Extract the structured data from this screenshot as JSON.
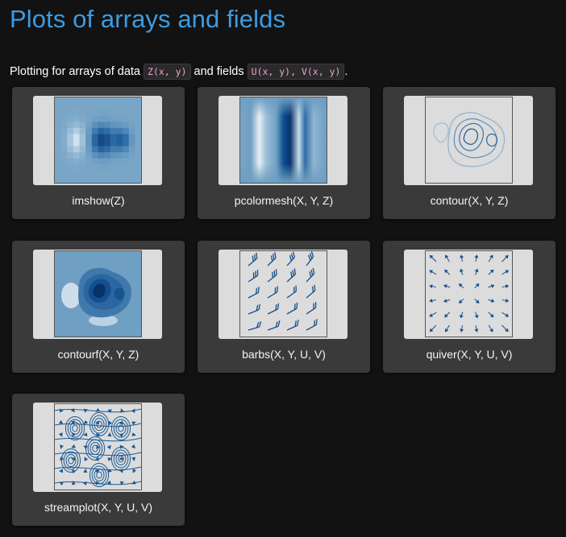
{
  "page": {
    "title": "Plots of arrays and fields",
    "intro_prefix": "Plotting for arrays of data ",
    "intro_code1": "Z(x, y)",
    "intro_middle": " and fields ",
    "intro_code2": "U(x, y), V(x, y)",
    "intro_suffix": "."
  },
  "colors": {
    "title": "#3d9be0",
    "background": "#121212",
    "card": "#3a3a3a",
    "plot_blue": "#0b4f91",
    "code_text": "#e9a6d4"
  },
  "gallery": [
    {
      "caption": "imshow(Z)",
      "plot": "imshow"
    },
    {
      "caption": "pcolormesh(X, Y, Z)",
      "plot": "pcolormesh"
    },
    {
      "caption": "contour(X, Y, Z)",
      "plot": "contour"
    },
    {
      "caption": "contourf(X, Y, Z)",
      "plot": "contourf"
    },
    {
      "caption": "barbs(X, Y, U, V)",
      "plot": "barbs"
    },
    {
      "caption": "quiver(X, Y, U, V)",
      "plot": "quiver"
    },
    {
      "caption": "streamplot(X, Y, U, V)",
      "plot": "streamplot"
    }
  ]
}
